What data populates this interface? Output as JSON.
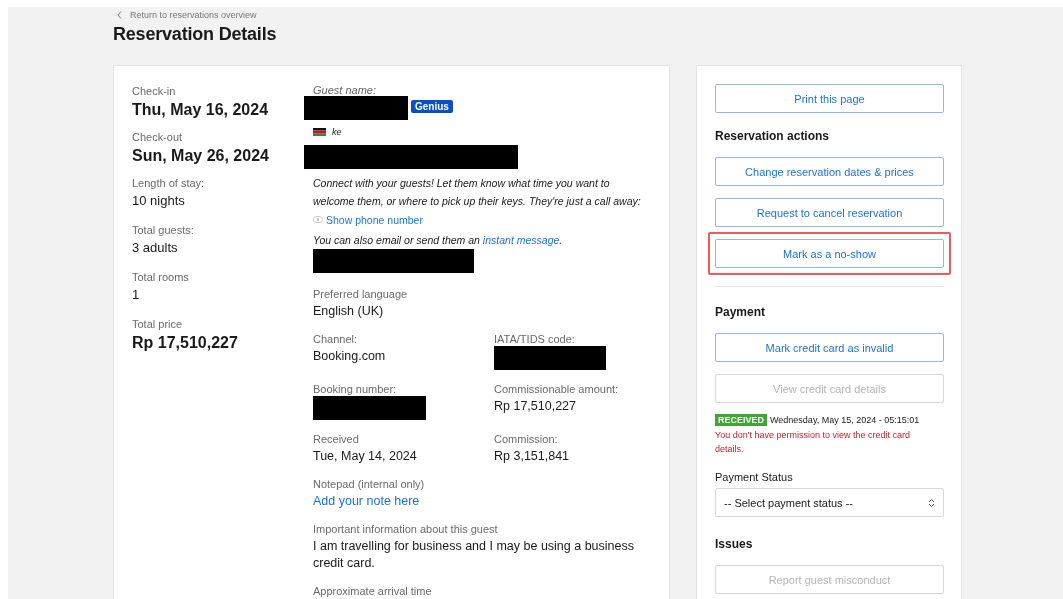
{
  "back_link": {
    "label": "Return to reservations overview"
  },
  "title": "Reservation Details",
  "stay": [
    {
      "label": "Check-in",
      "value": "Thu, May 16, 2024",
      "kind": "large"
    },
    {
      "label": "Check-out",
      "value": "Sun, May 26, 2024",
      "kind": "large"
    },
    {
      "label": "Length of stay:",
      "value": "10 nights",
      "kind": "normal"
    },
    {
      "label": "Total guests:",
      "value": "3 adults",
      "kind": "normal"
    },
    {
      "label": "Total rooms",
      "value": "1",
      "kind": "normal"
    },
    {
      "label": "Total price",
      "value": "Rp 17,510,227",
      "kind": "large"
    }
  ],
  "guest": {
    "name_label": "Guest name:",
    "badge": "Genius",
    "country": "ke",
    "connect_text": "Connect with your guests! Let them know what time you want to welcome them, or where to pick up their keys. They're just a call away:",
    "phone_link": "Show phone number",
    "message_text": "You can also email or send them an",
    "message_link": "instant message",
    "message_end": "."
  },
  "fields": [
    {
      "label": "Preferred language",
      "value": "English (UK)",
      "kind": "text"
    },
    {
      "label": "Channel:",
      "value": "Booking.com",
      "kind": "text"
    },
    {
      "label": "IATA/TIDS code:",
      "kind": "redacted"
    },
    {
      "label": "Booking number:",
      "kind": "redacted"
    },
    {
      "label": "Commissionable amount:",
      "value": "Rp 17,510,227",
      "kind": "text"
    },
    {
      "label": "Received",
      "value": "Tue, May 14, 2024",
      "kind": "text"
    },
    {
      "label": "Commission:",
      "value": "Rp 3,151,841",
      "kind": "text"
    },
    {
      "label": "Notepad (internal only)",
      "value": "Add your note here",
      "kind": "link"
    },
    {
      "label": "Important information about this guest",
      "value": "I am travelling for business and I may be using a business credit card.",
      "kind": "text"
    },
    {
      "label": "Approximate arrival time",
      "kind": "label_only"
    }
  ],
  "actions": [
    {
      "kind": "button",
      "label": "Print this page",
      "disabled": false,
      "highlighted": false
    },
    {
      "kind": "heading",
      "label": "Reservation actions"
    },
    {
      "kind": "button",
      "label": "Change reservation dates & prices",
      "disabled": false,
      "highlighted": false
    },
    {
      "kind": "button",
      "label": "Request to cancel reservation",
      "disabled": false,
      "highlighted": false
    },
    {
      "kind": "button",
      "label": "Mark as a no-show",
      "disabled": false,
      "highlighted": true
    },
    {
      "kind": "divider"
    },
    {
      "kind": "heading",
      "label": "Payment"
    },
    {
      "kind": "button",
      "label": "Mark credit card as invalid",
      "disabled": false,
      "highlighted": false
    },
    {
      "kind": "button",
      "label": "View credit card details",
      "disabled": true,
      "highlighted": false
    },
    {
      "kind": "status",
      "badge": "RECEIVED",
      "text": "Wednesday, May 15, 2024 - 05:15:01"
    },
    {
      "kind": "error",
      "text": "You don't have permission to view the credit card details."
    },
    {
      "kind": "select",
      "label": "Payment Status",
      "placeholder": "-- Select payment status --"
    },
    {
      "kind": "heading",
      "label": "Issues"
    },
    {
      "kind": "button",
      "label": "Report guest misconduct",
      "disabled": true,
      "highlighted": false
    }
  ]
}
